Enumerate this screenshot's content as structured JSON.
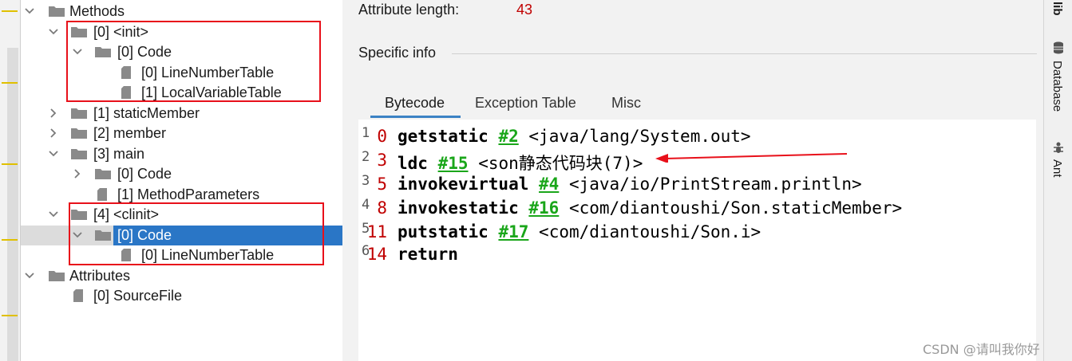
{
  "tree": {
    "rows": [
      {
        "label": "Methods",
        "chevron": "down",
        "icon": "folder"
      },
      {
        "label": "[0] <init>",
        "chevron": "down",
        "icon": "folder"
      },
      {
        "label": "[0] Code",
        "chevron": "down",
        "icon": "folder"
      },
      {
        "label": "[0] LineNumberTable",
        "chevron": "",
        "icon": "file"
      },
      {
        "label": "[1] LocalVariableTable",
        "chevron": "",
        "icon": "file"
      },
      {
        "label": "[1] staticMember",
        "chevron": "right",
        "icon": "folder"
      },
      {
        "label": "[2] member",
        "chevron": "right",
        "icon": "folder"
      },
      {
        "label": "[3] main",
        "chevron": "down",
        "icon": "folder"
      },
      {
        "label": "[0] Code",
        "chevron": "right",
        "icon": "folder"
      },
      {
        "label": "[1] MethodParameters",
        "chevron": "",
        "icon": "file"
      },
      {
        "label": "[4] <clinit>",
        "chevron": "down",
        "icon": "folder"
      },
      {
        "label": "[0] Code",
        "chevron": "down",
        "icon": "folder",
        "selected": true
      },
      {
        "label": "[0] LineNumberTable",
        "chevron": "",
        "icon": "file"
      },
      {
        "label": "Attributes",
        "chevron": "down",
        "icon": "folder"
      },
      {
        "label": "[0] SourceFile",
        "chevron": "",
        "icon": "file"
      }
    ]
  },
  "details": {
    "attr_length_label": "Attribute length:",
    "attr_length_value": "43",
    "specific_info": "Specific info",
    "tabs": [
      {
        "label": "Bytecode",
        "active": true
      },
      {
        "label": "Exception Table",
        "active": false
      },
      {
        "label": "Misc",
        "active": false
      }
    ]
  },
  "bytecode": [
    {
      "line": "1",
      "offset": "0",
      "op": "getstatic",
      "ref": "#2",
      "arg": "<java/lang/System.out>"
    },
    {
      "line": "2",
      "offset": "3",
      "op": "ldc",
      "ref": "#15",
      "arg": "<son静态代码块(7)>"
    },
    {
      "line": "3",
      "offset": "5",
      "op": "invokevirtual",
      "ref": "#4",
      "arg": "<java/io/PrintStream.println>"
    },
    {
      "line": "4",
      "offset": "8",
      "op": "invokestatic",
      "ref": "#16",
      "arg": "<com/diantoushi/Son.staticMember>"
    },
    {
      "line": "5",
      "offset": "11",
      "op": "putstatic",
      "ref": "#17",
      "arg": "<com/diantoushi/Son.i>"
    },
    {
      "line": "6",
      "offset": "14",
      "op": "return",
      "ref": "",
      "arg": ""
    }
  ],
  "sidebar": {
    "items": [
      {
        "label": "lib",
        "icon": "library-icon"
      },
      {
        "label": "Database",
        "icon": "database-icon"
      },
      {
        "label": "Ant",
        "icon": "ant-icon"
      }
    ]
  },
  "watermark": "CSDN @请叫我你好",
  "colors": {
    "selection": "#2a76c6",
    "annotation_red": "#e8101a",
    "offset_red": "#c00000",
    "ref_green": "#1aa61a",
    "tab_underline": "#3b82c4"
  }
}
